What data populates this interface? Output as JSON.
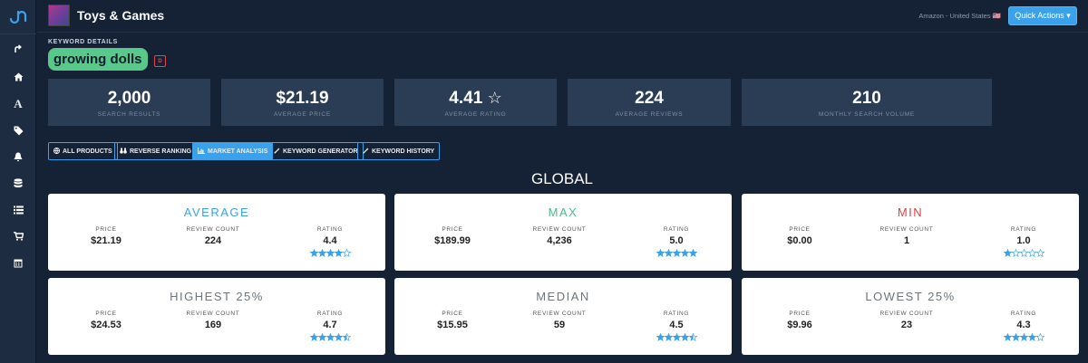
{
  "header": {
    "category_title": "Toys & Games",
    "marketplace": "Amazon - United States 🇺🇸",
    "quick_actions": "Quick Actions ▾"
  },
  "keyword": {
    "section_label": "KEYWORD DETAILS",
    "term": "growing dolls",
    "badge": "D"
  },
  "stats": [
    {
      "value": "2,000",
      "label": "SEARCH RESULTS"
    },
    {
      "value": "$21.19",
      "label": "AVERAGE PRICE"
    },
    {
      "value": "4.41",
      "label": "AVERAGE RATING"
    },
    {
      "value": "224",
      "label": "AVERAGE REVIEWS"
    },
    {
      "value": "210",
      "label": "MONTHLY SEARCH VOLUME"
    }
  ],
  "tabs": [
    {
      "icon": "globe-icon",
      "label": "ALL PRODUCTS"
    },
    {
      "icon": "binoculars-icon",
      "label": "REVERSE RANKING"
    },
    {
      "icon": "bar-chart-icon",
      "label": "MARKET ANALYSIS",
      "active": true
    },
    {
      "icon": "wand-icon",
      "label": "KEYWORD GENERATOR"
    },
    {
      "icon": "wand-icon",
      "label": "KEYWORD HISTORY"
    }
  ],
  "global_heading": "GLOBAL",
  "column_labels": {
    "price": "PRICE",
    "reviews": "REVIEW COUNT",
    "rating": "RATING"
  },
  "cards": [
    {
      "title": "AVERAGE",
      "title_color": "#3aa1ea",
      "price": "$21.19",
      "reviews": "224",
      "rating": "4.4",
      "stars": 4
    },
    {
      "title": "MAX",
      "title_color": "#4db88a",
      "price": "$189.99",
      "reviews": "4,236",
      "rating": "5.0",
      "stars": 5
    },
    {
      "title": "MIN",
      "title_color": "#d64545",
      "price": "$0.00",
      "reviews": "1",
      "rating": "1.0",
      "stars": 1
    },
    {
      "title": "HIGHEST 25%",
      "title_color": "#6c757d",
      "price": "$24.53",
      "reviews": "169",
      "rating": "4.7",
      "stars": 4.5
    },
    {
      "title": "MEDIAN",
      "title_color": "#6c757d",
      "price": "$15.95",
      "reviews": "59",
      "rating": "4.5",
      "stars": 4.5
    },
    {
      "title": "LOWEST 25%",
      "title_color": "#6c757d",
      "price": "$9.96",
      "reviews": "23",
      "rating": "4.3",
      "stars": 4
    }
  ],
  "colors": {
    "accent": "#3aa1ea",
    "star": "#3aa1ea",
    "pill": "#58c98a"
  },
  "sidebar_icons": [
    "logo-icon",
    "share-icon",
    "home-icon",
    "font-icon",
    "tags-icon",
    "bell-icon",
    "database-icon",
    "list-icon",
    "cart-icon",
    "calendar-icon"
  ]
}
